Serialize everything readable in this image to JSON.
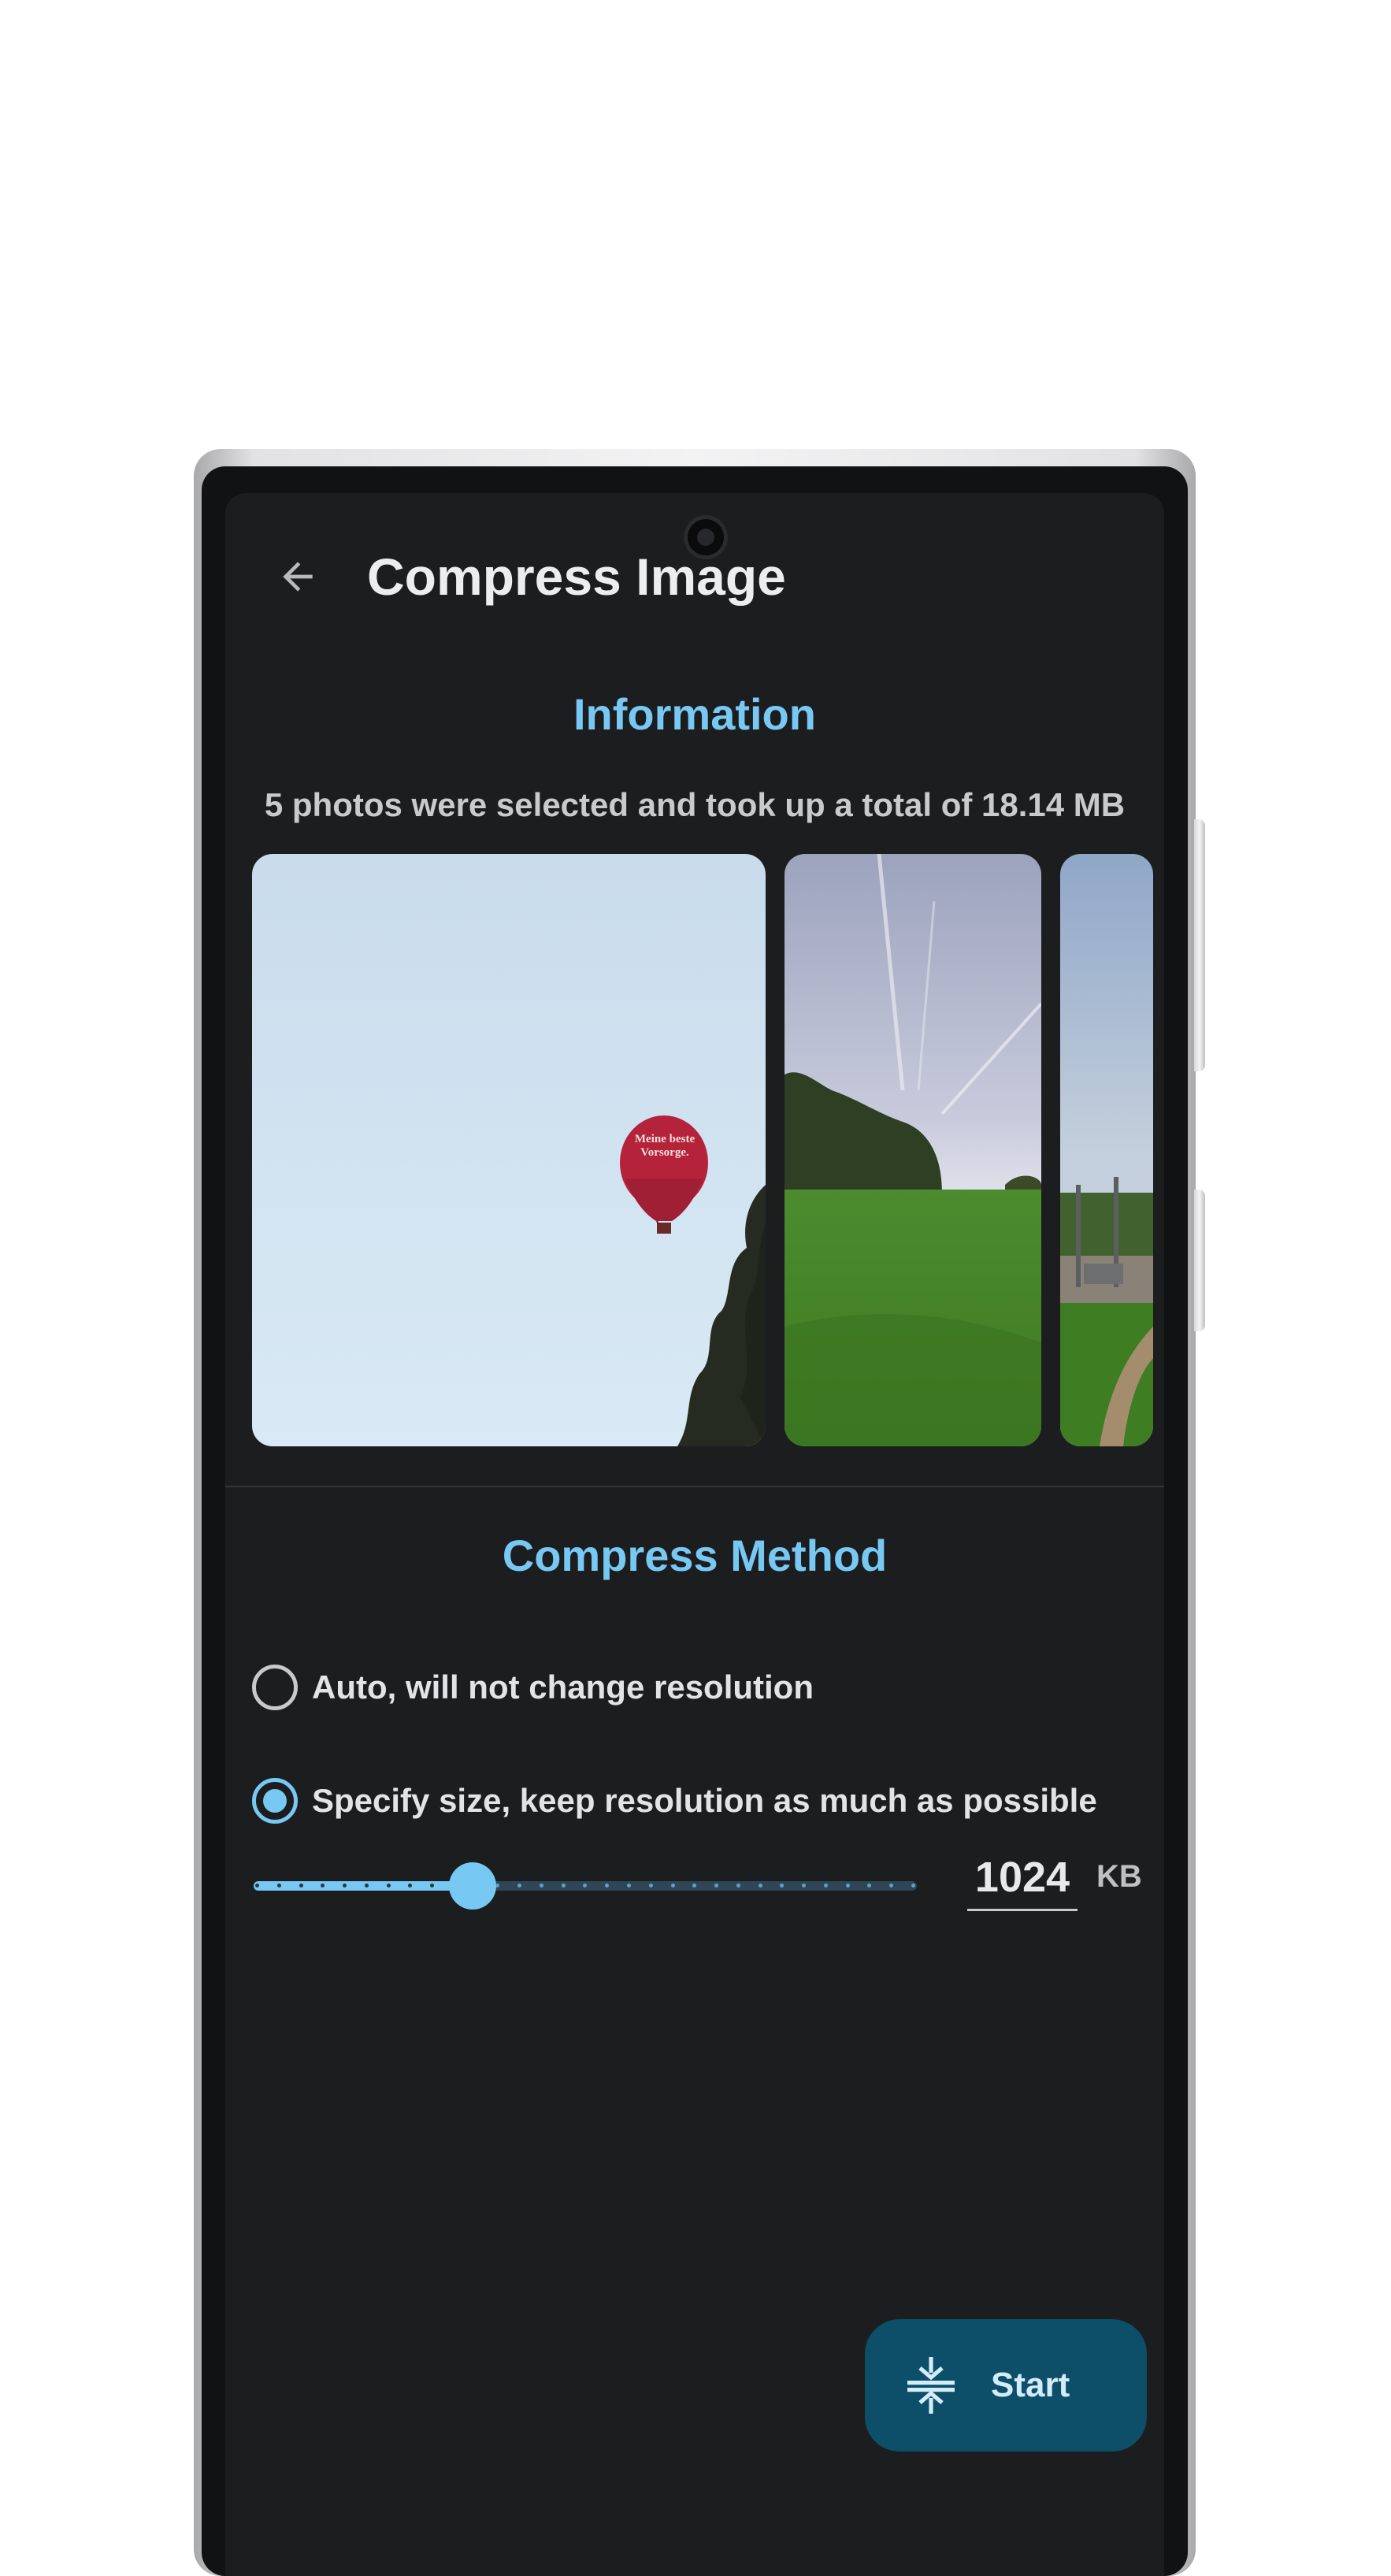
{
  "app_bar": {
    "title": "Compress Image",
    "back_icon": "arrow-back-icon"
  },
  "information": {
    "heading": "Information",
    "summary": "5 photos were selected and took up a total of 18.14 MB",
    "photos": [
      {
        "subject": "hot air balloon in pale sky with tree",
        "balloon_text": "Meine beste Vorsorge."
      },
      {
        "subject": "green meadow, treeline and sky with contrails"
      },
      {
        "subject": "playground by a field with path"
      }
    ]
  },
  "compress_method": {
    "heading": "Compress Method",
    "options": [
      {
        "label": "Auto, will not change resolution",
        "selected": false
      },
      {
        "label": "Specify size, keep resolution as much as possible",
        "selected": true
      }
    ],
    "size_slider": {
      "value_fraction": 0.33
    },
    "size_value": "1024",
    "size_unit": "KB"
  },
  "fab": {
    "label": "Start",
    "icon": "compress-icon"
  },
  "colors": {
    "accent": "#78c8f4",
    "background": "#1c1d1f",
    "fab_background": "#0d4e69"
  }
}
